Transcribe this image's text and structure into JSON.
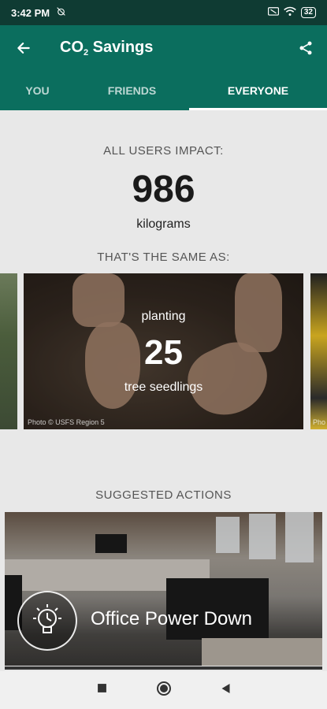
{
  "status_bar": {
    "time": "3:42 PM",
    "battery": "32"
  },
  "app_bar": {
    "title_main": "CO",
    "title_sub": "2",
    "title_rest": " Savings"
  },
  "tabs": [
    {
      "label": "YOU"
    },
    {
      "label": "FRIENDS"
    },
    {
      "label": "EVERYONE"
    }
  ],
  "impact": {
    "label": "ALL USERS IMPACT:",
    "value": "986",
    "unit": "kilograms"
  },
  "equivalence": {
    "label": "THAT'S THE SAME AS:",
    "card": {
      "pre_text": "planting",
      "value": "25",
      "post_text": "tree seedlings",
      "credit": "Photo © USFS Region 5"
    },
    "right_card_credit": "Pho"
  },
  "suggested": {
    "label": "SUGGESTED ACTIONS",
    "action_title": "Office Power Down"
  },
  "colors": {
    "status_bar": "#0f3b33",
    "primary": "#0b6e5e",
    "background": "#e8e8e8"
  }
}
